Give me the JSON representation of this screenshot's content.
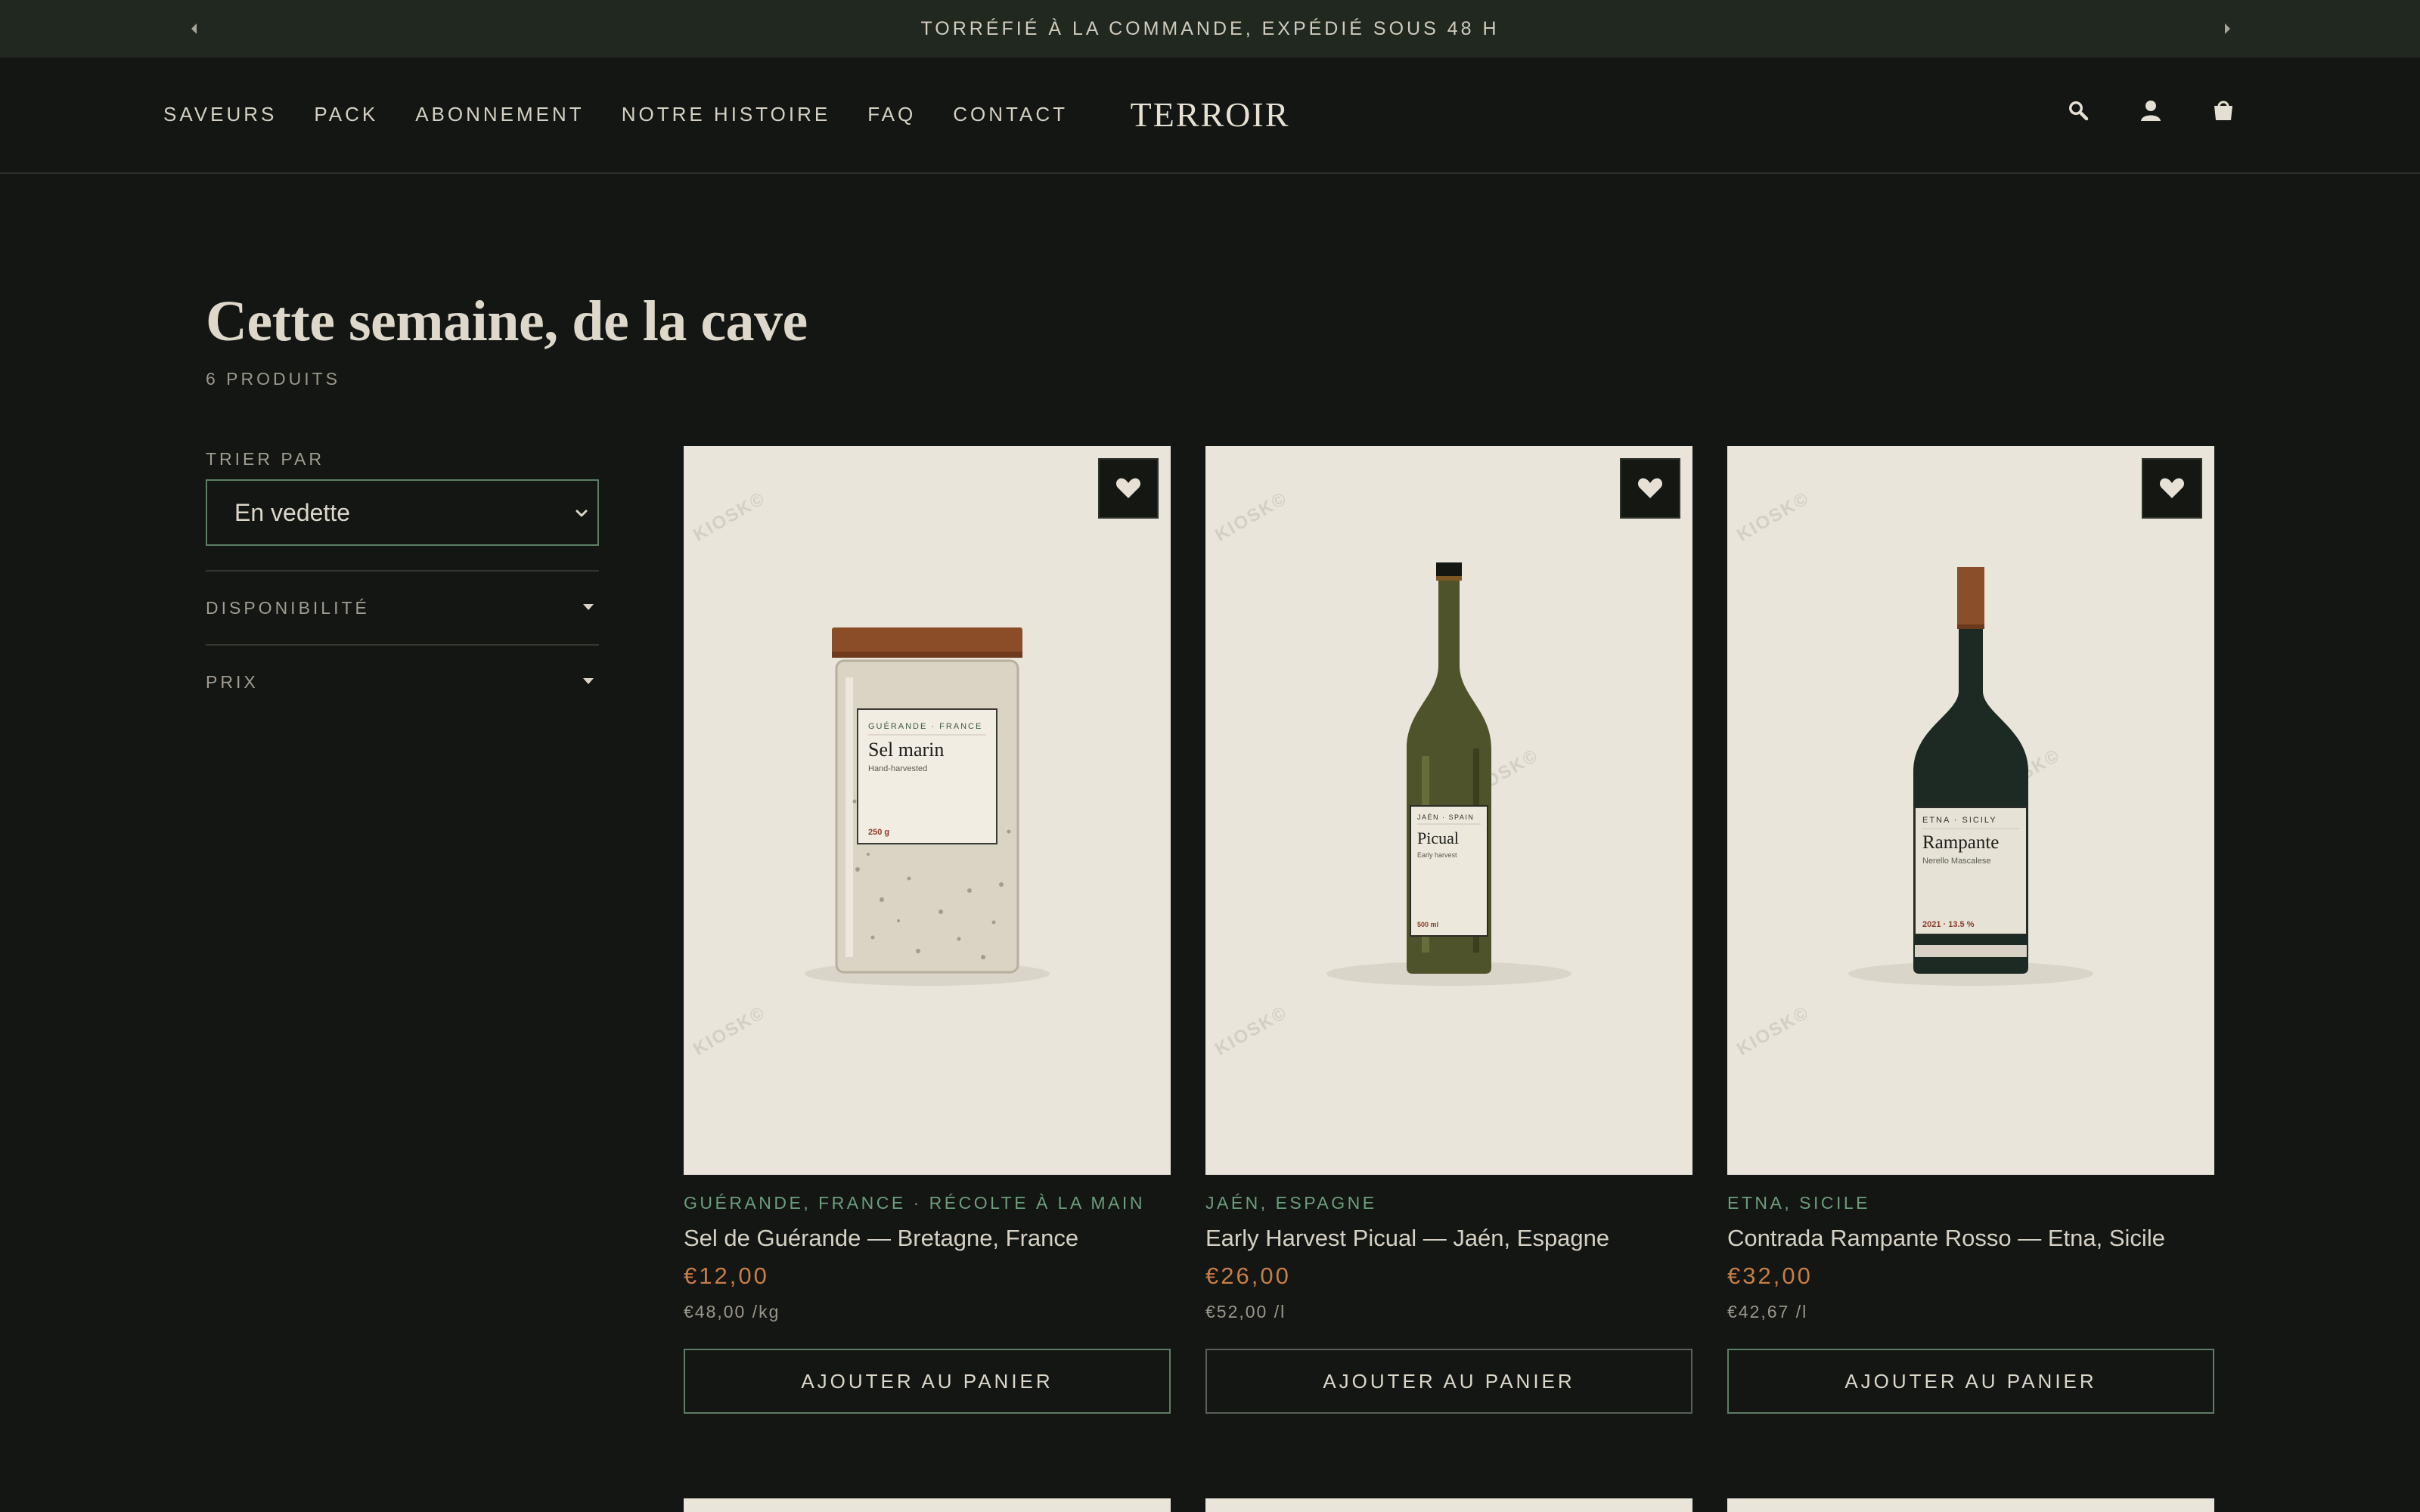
{
  "announcement": {
    "text": "TORRÉFIÉ À LA COMMANDE, EXPÉDIÉ SOUS 48 H",
    "prev_icon": "caret-left-icon",
    "next_icon": "caret-right-icon"
  },
  "header": {
    "nav": [
      "SAVEURS",
      "PACK",
      "ABONNEMENT",
      "NOTRE HISTOIRE",
      "FAQ",
      "CONTACT"
    ],
    "logo": "TERROIR",
    "icons": [
      "search-icon",
      "account-icon",
      "cart-icon"
    ]
  },
  "collection": {
    "title": "Cette semaine, de la cave",
    "count": "6 PRODUITS"
  },
  "sidebar": {
    "sort_label": "TRIER PAR",
    "sort_value": "En vedette",
    "filters": [
      "DISPONIBILITÉ",
      "PRIX"
    ]
  },
  "watermark": "KIOSK©",
  "products": [
    {
      "region": "GUÉRANDE, FRANCE · RÉCOLTE À LA MAIN",
      "name": "Sel de Guérande — Bretagne, France",
      "price": "€12,00",
      "unit_price": "€48,00 /kg",
      "button": "AJOUTER AU PANIER",
      "label": {
        "origin": "GUÉRANDE · FRANCE",
        "title": "Sel marin",
        "subtitle": "Hand-harvested",
        "size": "250 g"
      }
    },
    {
      "region": "JAÉN, ESPAGNE",
      "name": "Early Harvest Picual — Jaén, Espagne",
      "price": "€26,00",
      "unit_price": "€52,00 /l",
      "button": "AJOUTER AU PANIER",
      "label": {
        "origin": "JAÉN · SPAIN",
        "title": "Picual",
        "subtitle": "Early harvest",
        "size": "500 ml"
      }
    },
    {
      "region": "ETNA, SICILE",
      "name": "Contrada Rampante Rosso — Etna, Sicile",
      "price": "€32,00",
      "unit_price": "€42,67 /l",
      "button": "AJOUTER AU PANIER",
      "label": {
        "origin": "ETNA · SICILY",
        "title": "Rampante",
        "subtitle": "Nerello Mascalese",
        "size": "2021 · 13.5 %"
      }
    }
  ],
  "colors": {
    "background": "#131612",
    "announcement_bar": "#202820",
    "card": "#e9e5da",
    "accent_green": "#6c9d7d",
    "price": "#c77d48"
  }
}
